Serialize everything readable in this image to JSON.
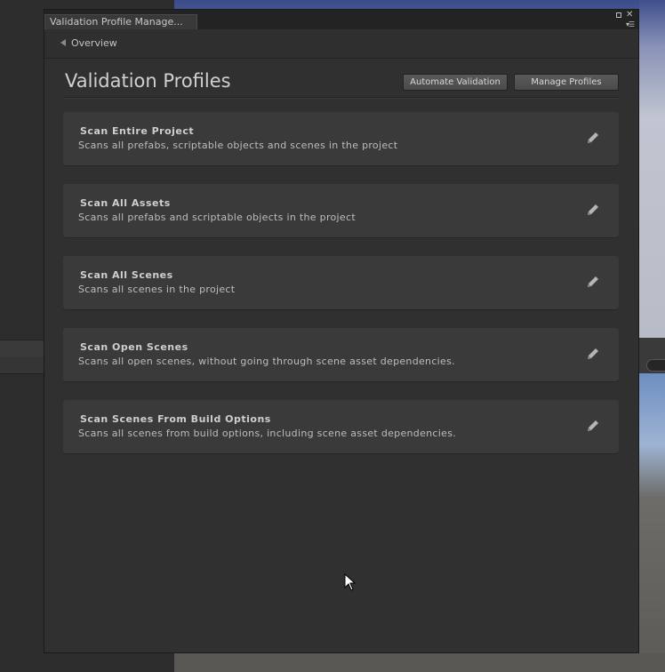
{
  "window": {
    "tab_title": "Validation Profile Manage...",
    "breadcrumb": "Overview"
  },
  "page": {
    "title": "Validation Profiles",
    "buttons": {
      "automate": "Automate Validation",
      "manage": "Manage Profiles"
    }
  },
  "profiles": [
    {
      "name": "Scan Entire Project",
      "description": "Scans all prefabs, scriptable objects and scenes in the project"
    },
    {
      "name": "Scan All Assets",
      "description": "Scans all prefabs and scriptable objects in the project"
    },
    {
      "name": "Scan All Scenes",
      "description": "Scans all scenes in the project"
    },
    {
      "name": "Scan Open Scenes",
      "description": "Scans all open scenes, without going through scene asset dependencies."
    },
    {
      "name": "Scan Scenes From Build Options",
      "description": "Scans all scenes from build options, including scene asset dependencies."
    }
  ],
  "icons": {
    "edit": "pencil-icon",
    "back": "chevron-left-icon",
    "close": "close-icon",
    "maximize": "maximize-icon",
    "menu": "menu-icon",
    "cursor": "mouse-cursor-icon"
  }
}
